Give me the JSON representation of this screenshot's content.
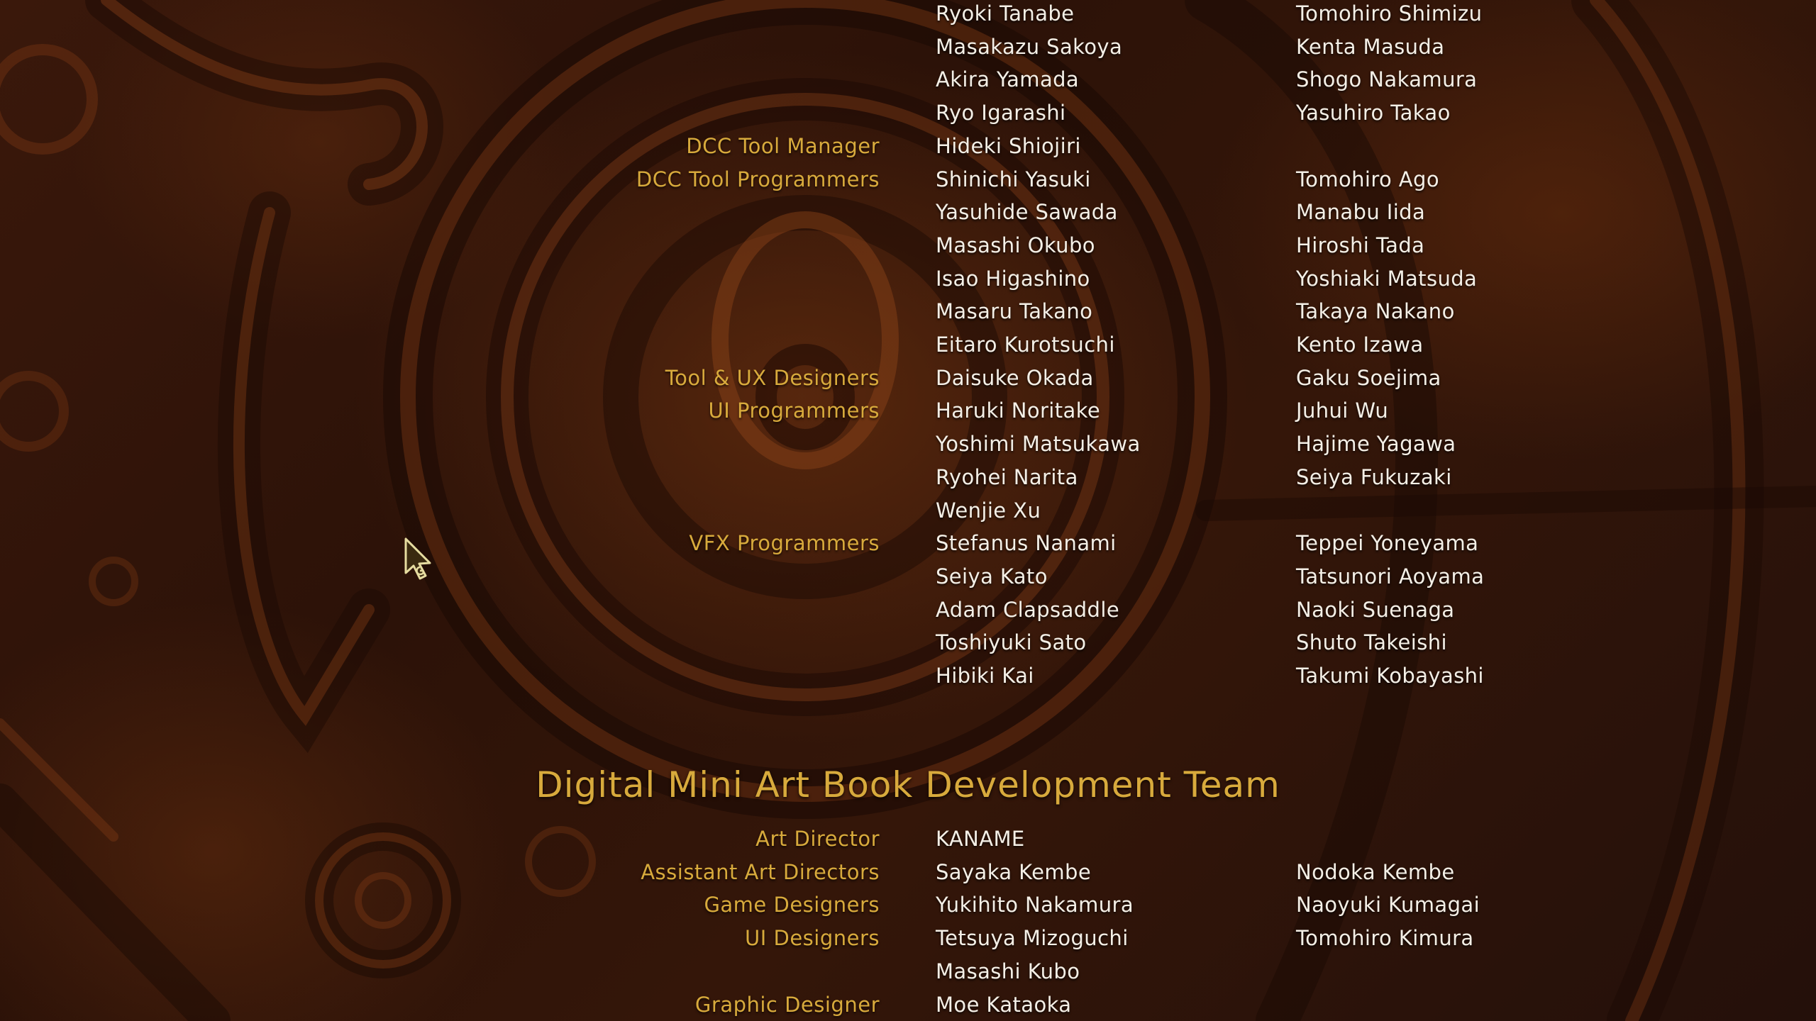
{
  "credits": {
    "rows": [
      {
        "role": "",
        "name1": "Ryoki Tanabe",
        "name2": "Tomohiro Shimizu"
      },
      {
        "role": "",
        "name1": "Masakazu Sakoya",
        "name2": "Kenta Masuda"
      },
      {
        "role": "",
        "name1": "Akira Yamada",
        "name2": "Shogo Nakamura"
      },
      {
        "role": "",
        "name1": "Ryo Igarashi",
        "name2": "Yasuhiro Takao"
      },
      {
        "role": "DCC Tool Manager",
        "name1": "Hideki Shiojiri",
        "name2": ""
      },
      {
        "role": "DCC Tool Programmers",
        "name1": "Shinichi Yasuki",
        "name2": "Tomohiro Ago"
      },
      {
        "role": "",
        "name1": "Yasuhide Sawada",
        "name2": "Manabu Iida"
      },
      {
        "role": "",
        "name1": "Masashi Okubo",
        "name2": "Hiroshi Tada"
      },
      {
        "role": "",
        "name1": "Isao Higashino",
        "name2": "Yoshiaki Matsuda"
      },
      {
        "role": "",
        "name1": "Masaru Takano",
        "name2": "Takaya Nakano"
      },
      {
        "role": "",
        "name1": "Eitaro Kurotsuchi",
        "name2": "Kento Izawa"
      },
      {
        "role": "Tool & UX Designers",
        "name1": "Daisuke Okada",
        "name2": "Gaku Soejima"
      },
      {
        "role": "UI Programmers",
        "name1": "Haruki Noritake",
        "name2": "Juhui Wu"
      },
      {
        "role": "",
        "name1": "Yoshimi Matsukawa",
        "name2": "Hajime Yagawa"
      },
      {
        "role": "",
        "name1": "Ryohei Narita",
        "name2": "Seiya Fukuzaki"
      },
      {
        "role": "",
        "name1": "Wenjie Xu",
        "name2": ""
      },
      {
        "role": "VFX Programmers",
        "name1": "Stefanus Nanami",
        "name2": "Teppei Yoneyama"
      },
      {
        "role": "",
        "name1": "Seiya Kato",
        "name2": "Tatsunori Aoyama"
      },
      {
        "role": "",
        "name1": "Adam Clapsaddle",
        "name2": "Naoki Suenaga"
      },
      {
        "role": "",
        "name1": "Toshiyuki Sato",
        "name2": "Shuto Takeishi"
      },
      {
        "role": "",
        "name1": "Hibiki Kai",
        "name2": "Takumi Kobayashi"
      }
    ],
    "section_title": "Digital Mini Art Book Development Team",
    "section_rows": [
      {
        "role": "Art Director",
        "name1": "KANAME",
        "name2": ""
      },
      {
        "role": "Assistant Art Directors",
        "name1": "Sayaka Kembe",
        "name2": "Nodoka Kembe"
      },
      {
        "role": "Game Designers",
        "name1": "Yukihito Nakamura",
        "name2": "Naoyuki Kumagai"
      },
      {
        "role": "UI Designers",
        "name1": "Tetsuya Mizoguchi",
        "name2": "Tomohiro Kimura"
      },
      {
        "role": "",
        "name1": "Masashi Kubo",
        "name2": ""
      },
      {
        "role": "Graphic Designer",
        "name1": "Moe Kataoka",
        "name2": ""
      }
    ]
  },
  "colors": {
    "role": "#d8aa3c",
    "name": "#f4efe6",
    "background": "#2c1208",
    "cursor": "#e6dca0"
  },
  "icons": {
    "cursor": "arrow-cursor-icon"
  }
}
